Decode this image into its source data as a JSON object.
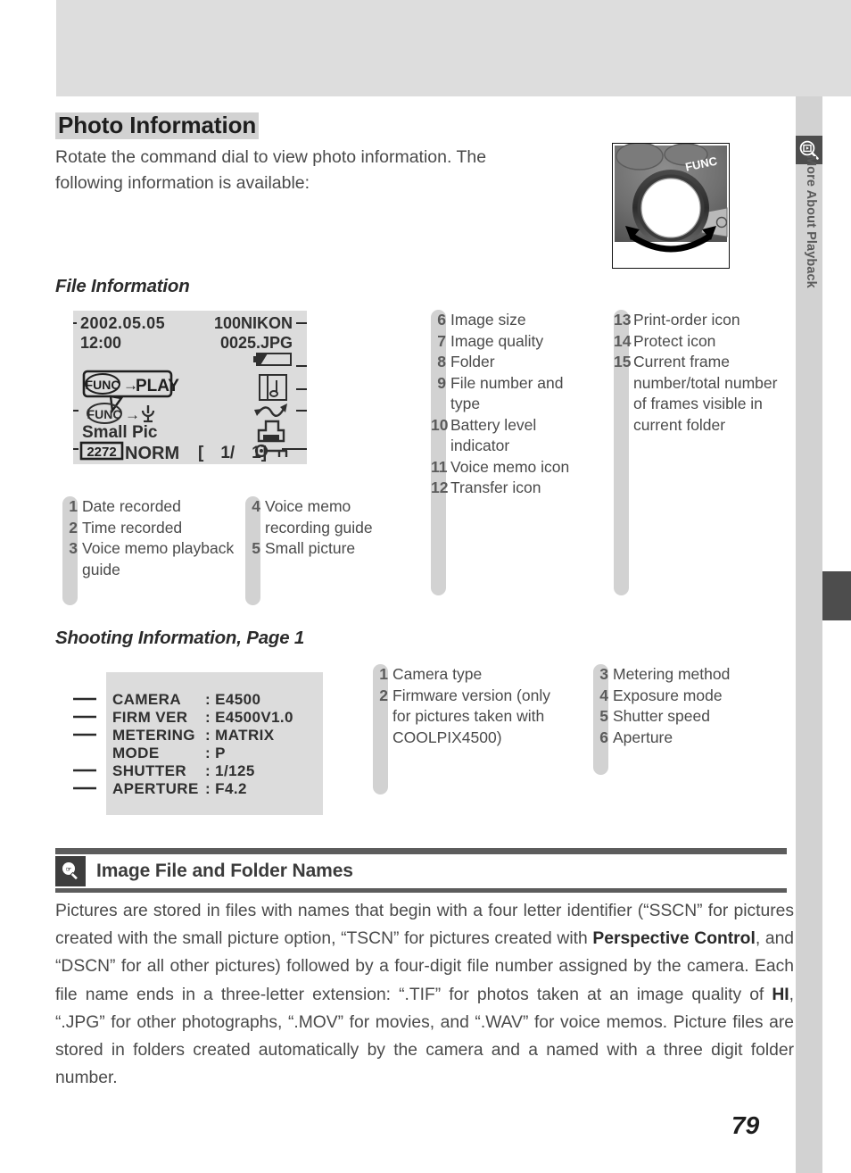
{
  "document": {
    "page_number": "79"
  },
  "side_tab": {
    "label": "More About Playback",
    "icon": "playback-magnifier-icon"
  },
  "section": {
    "title": "Photo Information",
    "intro": "Rotate the command dial to view photo information.  The following information is available:"
  },
  "camera_photo": {
    "func_label": "FUNC",
    "alt": "camera-command-dial-illustration"
  },
  "file_information": {
    "heading": "File Information",
    "lcd": {
      "date": "2002.05.05",
      "time": "12:00",
      "folder": "100NIKON",
      "file": "0025.JPG",
      "play_guide_func": "FUNC",
      "play_guide_arrow": "→",
      "play_guide_text": "PLAY",
      "memo_guide_func": "FUNC",
      "memo_guide_arrow": "→",
      "memo_guide_icon": "microphone-icon",
      "small_pic": "Small Pic",
      "image_size": "2272",
      "quality": "NORM",
      "frame_counter": "[   1/   1]",
      "icons": [
        "battery-icon",
        "voice-memo-icon",
        "transfer-icon",
        "print-order-icon",
        "protect-key-icon"
      ]
    },
    "items_col1": [
      {
        "n": "1",
        "label": "Date recorded"
      },
      {
        "n": "2",
        "label": "Time recorded"
      },
      {
        "n": "3",
        "label": "Voice memo playback guide"
      }
    ],
    "items_col2": [
      {
        "n": "4",
        "label": "Voice memo recording guide"
      },
      {
        "n": "5",
        "label": "Small picture"
      }
    ],
    "items_col3": [
      {
        "n": "6",
        "label": "Image size"
      },
      {
        "n": "7",
        "label": "Image quality"
      },
      {
        "n": "8",
        "label": "Folder"
      },
      {
        "n": "9",
        "label": "File number and type"
      },
      {
        "n": "10",
        "label": "Battery level indicator"
      },
      {
        "n": "11",
        "label": "Voice memo icon"
      },
      {
        "n": "12",
        "label": "Transfer icon"
      }
    ],
    "items_col4": [
      {
        "n": "13",
        "label": "Print-order icon"
      },
      {
        "n": "14",
        "label": "Protect icon"
      },
      {
        "n": "15",
        "label": "Current frame number/total number of frames visible in current folder"
      }
    ]
  },
  "shooting_information": {
    "heading": "Shooting Information, Page 1",
    "lcd_rows": [
      {
        "label": "CAMERA",
        "value": ": E4500"
      },
      {
        "label": "FIRM VER",
        "value": ": E4500V1.0"
      },
      {
        "label": "METERING",
        "value": ": MATRIX"
      },
      {
        "label": "MODE",
        "value": ": P"
      },
      {
        "label": "SHUTTER",
        "value": ": 1/125"
      },
      {
        "label": "APERTURE",
        "value": ": F4.2"
      }
    ],
    "items_col1": [
      {
        "n": "1",
        "label": "Camera type"
      },
      {
        "n": "2",
        "label": "Firmware version (only for pictures taken with COOLPIX4500)"
      }
    ],
    "items_col2": [
      {
        "n": "3",
        "label": "Metering method"
      },
      {
        "n": "4",
        "label": "Exposure mode"
      },
      {
        "n": "5",
        "label": "Shutter speed"
      },
      {
        "n": "6",
        "label": "Aperture"
      }
    ]
  },
  "tip": {
    "icon": "lightbulb-tip-icon",
    "title": "Image File and Folder Names",
    "body_part_1": "Pictures are stored in files with names that begin with a four letter identifier (“SSCN” for pictures created with the small picture option, “TSCN” for pictures created with ",
    "body_bold_1": "Perspective Control",
    "body_part_2": ", and “DSCN” for all other pictures) followed by a four-digit file number assigned by the camera.  Each file name ends in a three-letter extension: “.TIF” for photos taken at an image quality of ",
    "body_bold_2": "HI",
    "body_part_3": ", “.JPG” for other photographs, “.MOV” for movies, and “.WAV” for voice memos.  Picture files are stored in folders created automatically by the camera and a named with a three digit folder number."
  },
  "colors": {
    "band_gray": "#dddddd",
    "column_gray": "#d2d2d2",
    "lcd_gray": "#dcdcdc",
    "rule_dark": "#5c5c5c",
    "text": "#4a4a4a"
  }
}
